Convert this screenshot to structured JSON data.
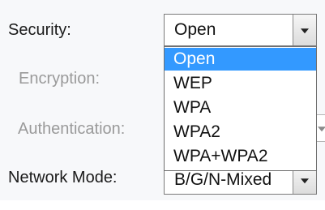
{
  "form": {
    "security_label": "Security:",
    "encryption_label": "Encryption:",
    "authentication_label": "Authentication:",
    "network_mode_label": "Network Mode:"
  },
  "security_select": {
    "value": "Open",
    "expanded": true,
    "options": [
      "Open",
      "WEP",
      "WPA",
      "WPA2",
      "WPA+WPA2"
    ],
    "selected_index": 0
  },
  "network_mode_select": {
    "value": "B/G/N-Mixed"
  },
  "colors": {
    "selection_highlight": "#3399ff",
    "disabled_text": "#9a9a9a"
  }
}
